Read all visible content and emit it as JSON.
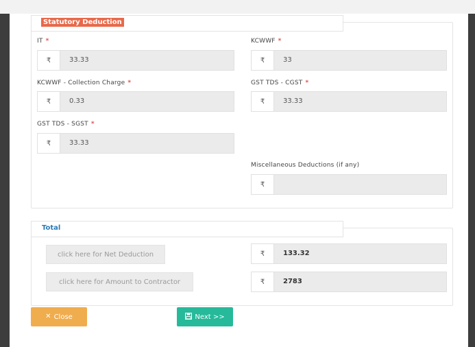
{
  "statutory": {
    "legend": "Statutory Deduction",
    "fields": {
      "it": {
        "label": "IT",
        "currency": "₹",
        "value": "33.33"
      },
      "kcwwf": {
        "label": "KCWWF",
        "currency": "₹",
        "value": "33"
      },
      "kcwwf_collection": {
        "label": "KCWWF - Collection Charge",
        "currency": "₹",
        "value": "0.33"
      },
      "gst_cgst": {
        "label": "GST TDS - CGST",
        "currency": "₹",
        "value": "33.33"
      },
      "gst_sgst": {
        "label": "GST TDS - SGST",
        "currency": "₹",
        "value": "33.33"
      },
      "misc": {
        "label": "Miscellaneous Deductions (if any)",
        "currency": "₹",
        "value": ""
      }
    },
    "required_mark": "*"
  },
  "total": {
    "legend": "Total",
    "net_deduction_button": "click here for Net Deduction",
    "net_deduction": {
      "currency": "₹",
      "value": "133.32"
    },
    "amount_contractor_button": "click here for Amount to Contractor",
    "amount_contractor": {
      "currency": "₹",
      "value": "2783"
    }
  },
  "actions": {
    "close_label": "Close",
    "next_label": "Next >>"
  },
  "icons": {
    "close": "times-icon",
    "next": "save-icon"
  },
  "colors": {
    "legend_statutory_bg": "#e8694a",
    "legend_total_text": "#2a7ab8",
    "required": "#d9534f",
    "close_btn": "#f0ad4e",
    "next_btn": "#26b99a"
  }
}
